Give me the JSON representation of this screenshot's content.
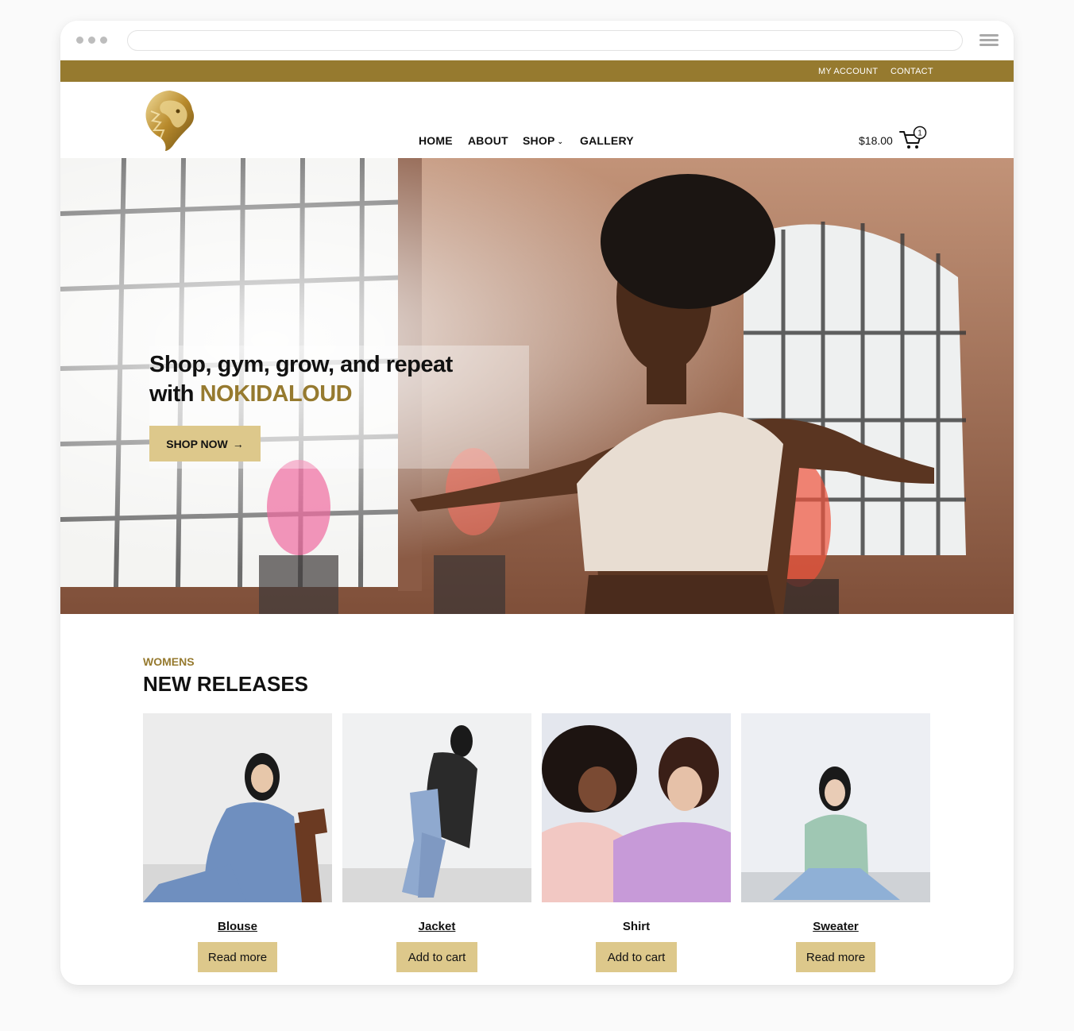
{
  "topbar": {
    "my_account": "MY ACCOUNT",
    "contact": "CONTACT",
    "color": "#967a2f"
  },
  "nav": {
    "home": "HOME",
    "about": "ABOUT",
    "shop": "SHOP",
    "gallery": "GALLERY"
  },
  "cart": {
    "total": "$18.00",
    "count": "1"
  },
  "hero": {
    "title_line1": "Shop, gym, grow, and repeat",
    "title_with": "with",
    "brand": "NOKIDALOUD",
    "cta": "SHOP NOW",
    "cta_arrow": "→"
  },
  "releases": {
    "kicker": "WOMENS",
    "title": "NEW RELEASES",
    "products": [
      {
        "name": "Blouse",
        "button": "Read more"
      },
      {
        "name": "Jacket",
        "button": "Add to cart"
      },
      {
        "name": "Shirt",
        "button": "Add to cart"
      },
      {
        "name": "Sweater",
        "button": "Read more"
      }
    ]
  },
  "colors": {
    "accent": "#967a2f",
    "button": "#ddc88b"
  }
}
